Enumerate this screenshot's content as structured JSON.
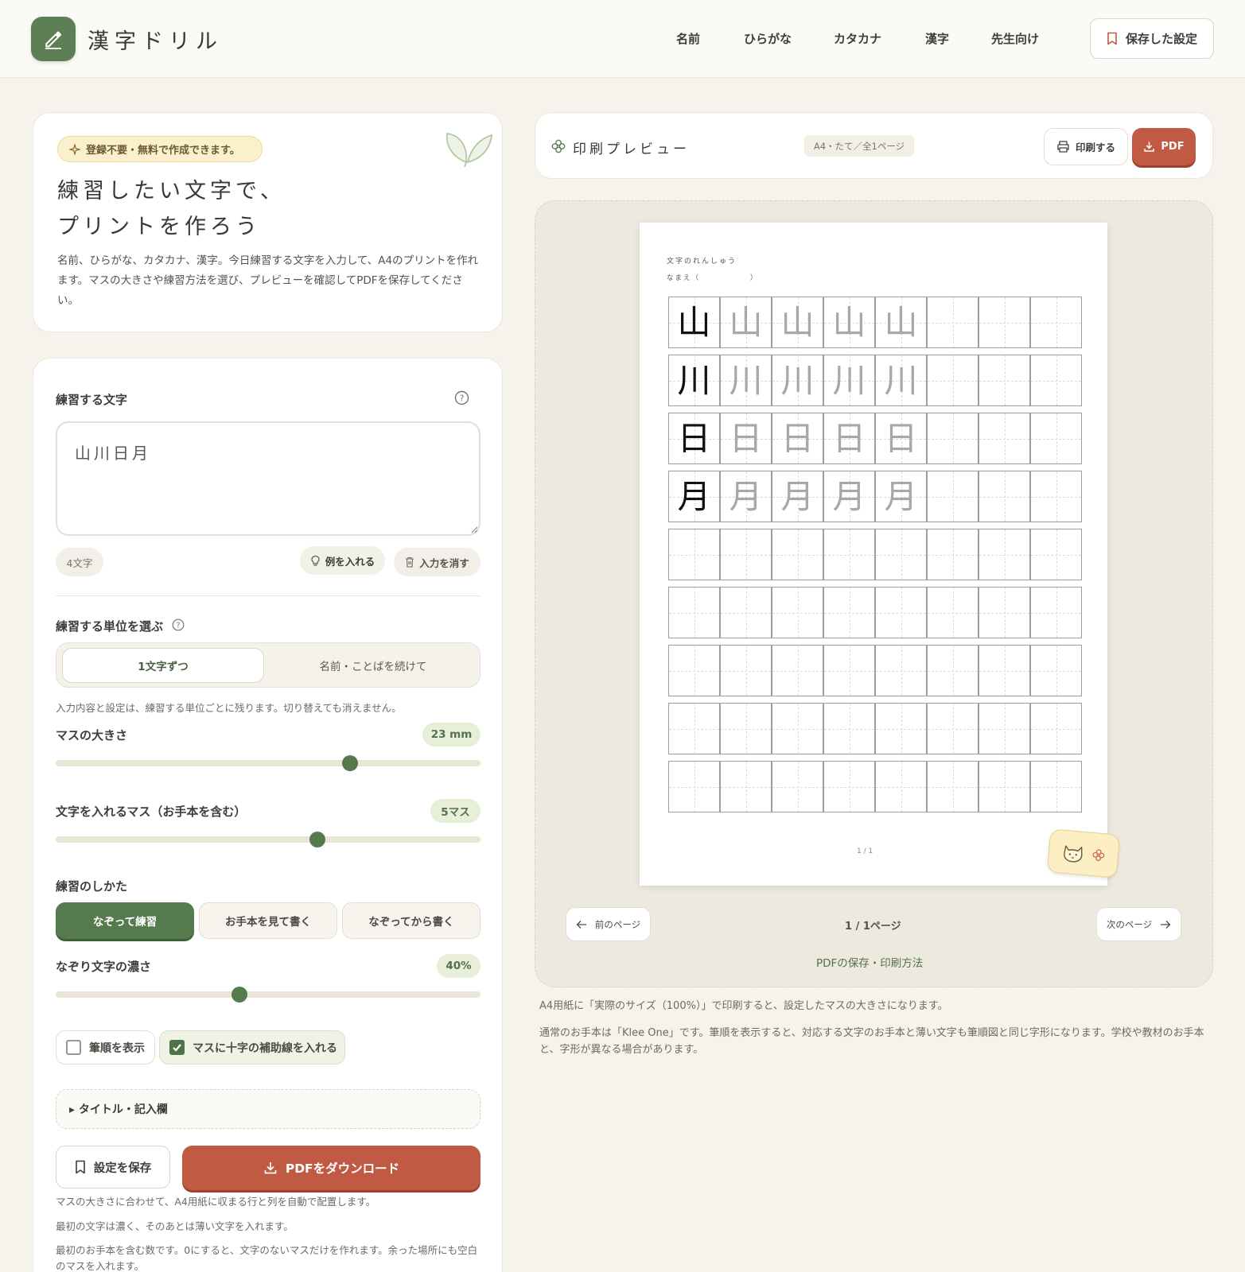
{
  "header": {
    "logo": "漢字ドリル",
    "nav": [
      "名前",
      "ひらがな",
      "カタカナ",
      "漢字",
      "先生向け"
    ],
    "saved_settings": "保存した設定"
  },
  "hero": {
    "badge": "登録不要・無料で作成できます。",
    "title_line1": "練習したい文字で、",
    "title_line2": "プリントを作ろう",
    "description": "名前、ひらがな、カタカナ、漢字。今日練習する文字を入力して、A4のプリントを作れます。マスの大きさや練習方法を選び、プレビューを確認してPDFを保存してください。"
  },
  "form": {
    "chars_label": "練習する文字",
    "chars_value": "山川日月",
    "char_count": "4文字",
    "example_button": "例を入れる",
    "clear_button": "入力を消す",
    "unit_label": "練習する単位を選ぶ",
    "unit_options": [
      "1文字ずつ",
      "名前・ことばを続けて"
    ],
    "unit_note": "入力内容と設定は、練習する単位ごとに残ります。切り替えても消えません。",
    "size_label": "マスの大きさ",
    "size_value": "23 mm",
    "size_level": 0.7,
    "cells_label": "文字を入れるマス（お手本を含む）",
    "cells_value": "5マス",
    "cells_level": 0.62,
    "method_label": "練習のしかた",
    "method_options": [
      "なぞって練習",
      "お手本を見て書く",
      "なぞってから書く"
    ],
    "density_label": "なぞり文字の濃さ",
    "density_value": "40%",
    "density_level": 0.43,
    "stroke_order": "筆順を表示",
    "cross_guide": "マスに十字の補助線を入れる",
    "title_section": "▸ タイトル・記入欄",
    "save_button": "設定を保存",
    "download_button": "PDFをダウンロード",
    "help": [
      "マスの大きさに合わせて、A4用紙に収まる行と列を自動で配置します。",
      "最初の文字は濃く、そのあとは薄い文字を入れます。",
      "最初のお手本を含む数です。0にすると、文字のないマスだけを作れます。余った場所にも空白のマスを入れます。"
    ]
  },
  "preview": {
    "title": "印刷プレビュー",
    "tag": "A4・たて／全1ページ",
    "print_button": "印刷する",
    "pdf_button": "PDF",
    "sheet_title": "文字のれんしゅう",
    "sheet_name": "なまえ（　　　　　　）",
    "sheet_page": "1 / 1",
    "rows": [
      "山",
      "川",
      "日",
      "月"
    ],
    "prev_page": "前のページ",
    "page_indicator": "1 / 1ページ",
    "next_page": "次のページ",
    "pdf_help_link": "PDFの保存・印刷方法",
    "note1": "A4用紙に「実際のサイズ（100%）」で印刷すると、設定したマスの大きさになります。",
    "note2": "通常のお手本は「Klee One」です。筆順を表示すると、対応する文字のお手本と薄い文字も筆順図と同じ字形になります。学校や教材のお手本と、字形が異なる場合があります。"
  },
  "colors": {
    "accent_green": "#5d7f56",
    "accent_red": "#c05a43",
    "bg": "#f6f3ec"
  }
}
